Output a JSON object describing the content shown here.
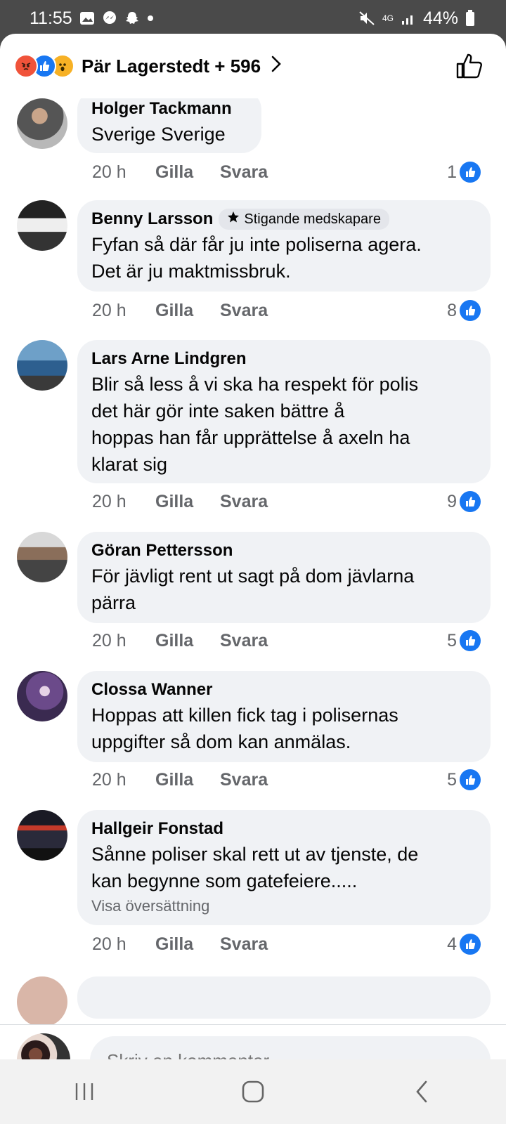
{
  "status_bar": {
    "time": "11:55",
    "battery": "44%",
    "network": "4G",
    "icons": [
      "gallery-icon",
      "messenger-icon",
      "snapchat-icon",
      "dot-icon",
      "mute-icon",
      "signal-icon",
      "battery-icon"
    ]
  },
  "header": {
    "reactions": [
      "angry",
      "like",
      "wow"
    ],
    "reactors_label": "Pär Lagerstedt + 596",
    "like_button_icon": "thumbs-up-outline-icon"
  },
  "comments": [
    {
      "author": "Holger Tackmann",
      "text_lines": [
        "Sverige Sverige"
      ],
      "time": "20 h",
      "like_label": "Gilla",
      "reply_label": "Svara",
      "likes": "1"
    },
    {
      "author": "Benny Larsson",
      "badge": "Stigande medskapare",
      "text_lines": [
        "Fyfan så där får ju inte poliserna agera.",
        "Det är ju maktmissbruk."
      ],
      "time": "20 h",
      "like_label": "Gilla",
      "reply_label": "Svara",
      "likes": "8"
    },
    {
      "author": "Lars Arne Lindgren",
      "text_lines": [
        "Blir  så less  å vi ska ha respekt  för  polis",
        "det  här  gör  inte  saken  bättre  å",
        "hoppas   han får  upprättelse  å axeln  ha",
        "klarat  sig"
      ],
      "time": "20 h",
      "like_label": "Gilla",
      "reply_label": "Svara",
      "likes": "9"
    },
    {
      "author": "Göran Pettersson",
      "text_lines": [
        "För jävligt rent ut sagt på dom jävlarna",
        "pärra"
      ],
      "time": "20 h",
      "like_label": "Gilla",
      "reply_label": "Svara",
      "likes": "5"
    },
    {
      "author": "Clossa Wanner",
      "text_lines": [
        "Hoppas att killen fick tag i polisernas",
        "uppgifter så dom kan anmälas."
      ],
      "time": "20 h",
      "like_label": "Gilla",
      "reply_label": "Svara",
      "likes": "5"
    },
    {
      "author": "Hallgeir Fonstad",
      "text_lines": [
        "Sånne poliser skal rett ut av tjenste, de",
        "kan begynne som gatefeiere....."
      ],
      "translate_label": "Visa översättning",
      "time": "20 h",
      "like_label": "Gilla",
      "reply_label": "Svara",
      "likes": "4"
    }
  ],
  "composer": {
    "placeholder": "Skriv en kommentar ..."
  },
  "colors": {
    "accent": "#1877f2",
    "bubble": "#f0f2f5",
    "meta": "#65676b"
  }
}
